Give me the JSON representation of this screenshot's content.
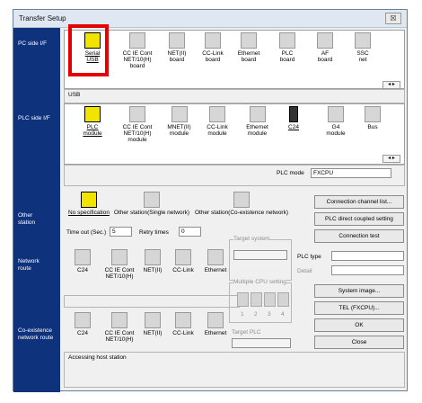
{
  "window": {
    "title": "Transfer Setup",
    "close": "☒"
  },
  "sections": {
    "pc_if": "PC side I/F",
    "plc_if": "PLC side I/F",
    "other_station": "Other\nstation",
    "network_route": "Network\nroute",
    "coexist_route": "Co-existence\nnetwork route"
  },
  "pc_side": {
    "items": [
      "Serial\nUSB",
      "CC IE Cont\nNET/10(H)\nboard",
      "NET(II)\nboard",
      "CC-Link\nboard",
      "Ethernet\nboard",
      "PLC\nboard",
      "AF\nboard",
      "SSC\nnet"
    ],
    "selected_value": "USB"
  },
  "plc_side": {
    "items": [
      "PLC\nmodule",
      "CC IE Cont\nNET/10(H)\nmodule",
      "MNET(II)\nmodule",
      "CC-Link\nmodule",
      "Ethernet\nmodule",
      "C24",
      "G4\nmodule",
      "Bus"
    ],
    "plc_mode_label": "PLC mode",
    "plc_mode_value": "FXCPU"
  },
  "other_station": {
    "items": [
      "No specification",
      "Other station(Single network)",
      "Other station(Co-existence network)"
    ],
    "timeout_label": "Time out (Sec.)",
    "timeout_value": "5",
    "retry_label": "Retry times",
    "retry_value": "0"
  },
  "network_route": {
    "items": [
      "C24",
      "CC IE Cont\nNET/10(H)",
      "NET(II)",
      "CC-Link",
      "Ethernet"
    ]
  },
  "coexist_route": {
    "items": [
      "C24",
      "CC IE Cont\nNET/10(H)",
      "NET(II)",
      "CC-Link",
      "Ethernet"
    ],
    "status": "Accessing host station"
  },
  "target_system": {
    "label": "Target system"
  },
  "multi_cpu": {
    "label": "Multiple CPU setting",
    "cpus": [
      "1",
      "2",
      "3",
      "4"
    ]
  },
  "target_plc": {
    "label": "Target PLC"
  },
  "plc_type": {
    "label": "PLC type",
    "detail_label": "Detail"
  },
  "buttons": {
    "conn_channel": "Connection channel list...",
    "plc_direct": "PLC direct coupled setting",
    "conn_test": "Connection test",
    "system_image": "System image...",
    "tel": "TEL (FXCPU)...",
    "ok": "OK",
    "close": "Close"
  },
  "scroll": "◂ ▸"
}
